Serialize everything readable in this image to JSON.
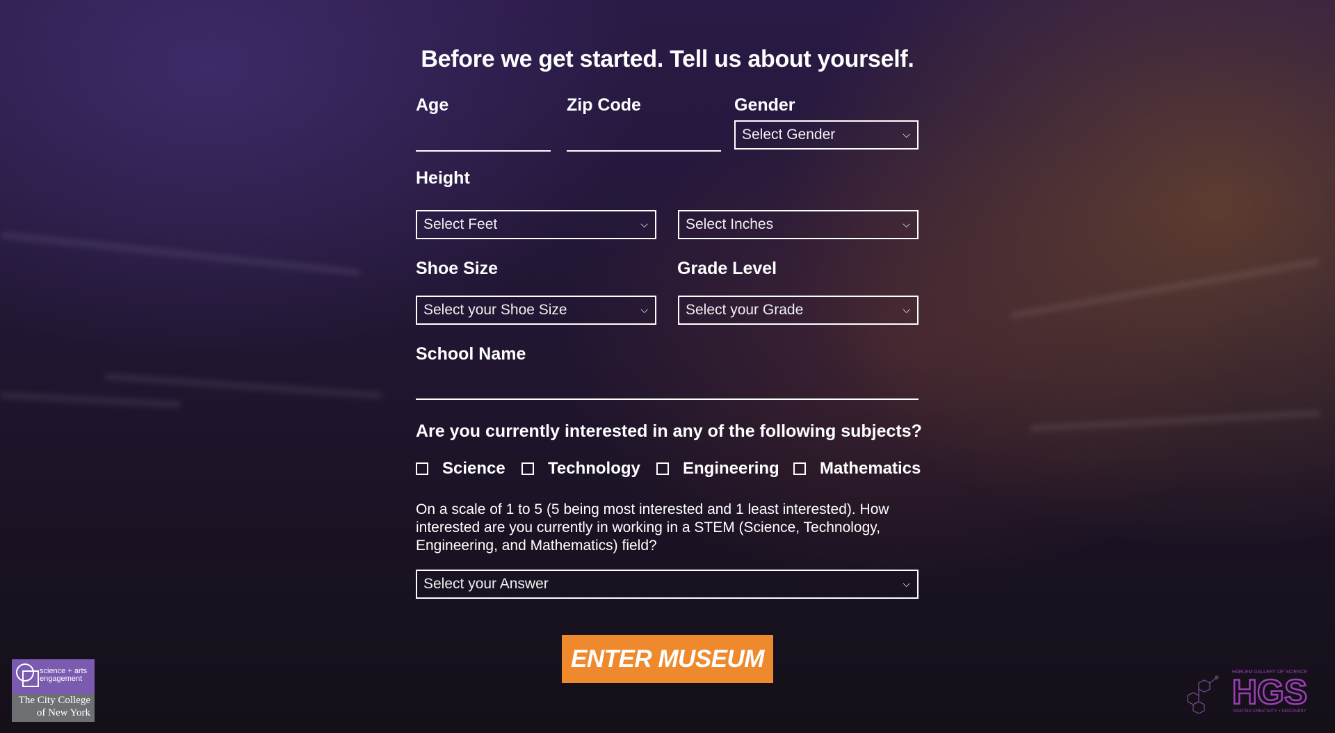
{
  "title": "Before we get started. Tell us about yourself.",
  "fields": {
    "age": {
      "label": "Age",
      "value": ""
    },
    "zip": {
      "label": "Zip Code",
      "value": ""
    },
    "gender": {
      "label": "Gender",
      "selected": "Select Gender"
    },
    "height": {
      "label": "Height",
      "feet": "Select Feet",
      "inches": "Select Inches"
    },
    "shoe": {
      "label": "Shoe Size",
      "selected": "Select your Shoe Size"
    },
    "grade": {
      "label": "Grade Level",
      "selected": "Select your Grade"
    },
    "school": {
      "label": "School Name",
      "value": ""
    }
  },
  "subjects": {
    "question": "Are you currently interested in any of the following subjects?",
    "options": [
      "Science",
      "Technology",
      "Engineering",
      "Mathematics"
    ]
  },
  "scale": {
    "question": "On a scale of 1 to 5 (5 being most interested and 1 least interested). How interested are you currently in working in a STEM (Science, Technology, Engineering, and Mathematics) field?",
    "selected": "Select your Answer"
  },
  "button": {
    "label": "ENTER MUSEUM"
  },
  "logos": {
    "ccny_top": "science + arts engagement",
    "ccny_bottom_1": "The City College",
    "ccny_bottom_2": "of New York",
    "hgs_name": "HARLEM GALLERY OF SCIENCE",
    "hgs_letters": "HGS",
    "hgs_tagline": "IGNITING CREATIVITY + DISCOVERY"
  },
  "colors": {
    "accent": "#ee8a2d",
    "logo_purple": "#7a5bb0",
    "hgs_magenta": "#9b3fb5"
  }
}
